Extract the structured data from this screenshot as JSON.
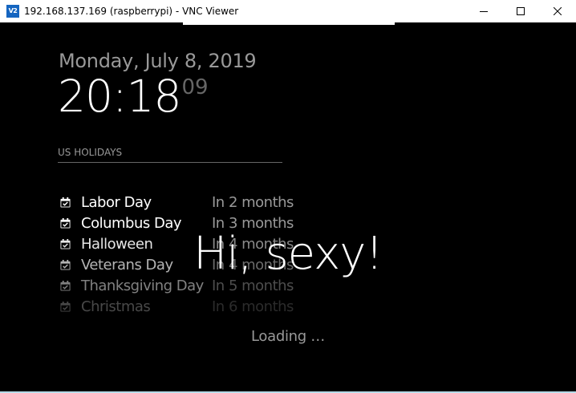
{
  "window": {
    "title": "192.168.137.169 (raspberrypi) - VNC Viewer",
    "app_icon_text": "V2"
  },
  "colors": {
    "background": "#000000",
    "primary_text": "#ffffff",
    "secondary_text": "#999999",
    "dim_text": "#666666"
  },
  "mirror": {
    "date": "Monday, July 8, 2019",
    "time": "20:18",
    "seconds": "09",
    "holidays_header": "US HOLIDAYS",
    "holidays": [
      {
        "name": "Labor Day",
        "when": "In 2 months",
        "opacity": 1.0,
        "icon": "calendar-check-icon"
      },
      {
        "name": "Columbus Day",
        "when": "In 3 months",
        "opacity": 1.0,
        "icon": "calendar-check-icon"
      },
      {
        "name": "Halloween",
        "when": "In 4 months",
        "opacity": 0.9,
        "icon": "calendar-check-icon"
      },
      {
        "name": "Veterans Day",
        "when": "In 4 months",
        "opacity": 0.7,
        "icon": "calendar-check-icon"
      },
      {
        "name": "Thanksgiving Day",
        "when": "In 5 months",
        "opacity": 0.5,
        "icon": "calendar-check-icon"
      },
      {
        "name": "Christmas",
        "when": "In 6 months",
        "opacity": 0.28,
        "icon": "calendar-check-icon"
      }
    ],
    "compliment": "Hi, sexy!",
    "loading": "Loading …"
  }
}
